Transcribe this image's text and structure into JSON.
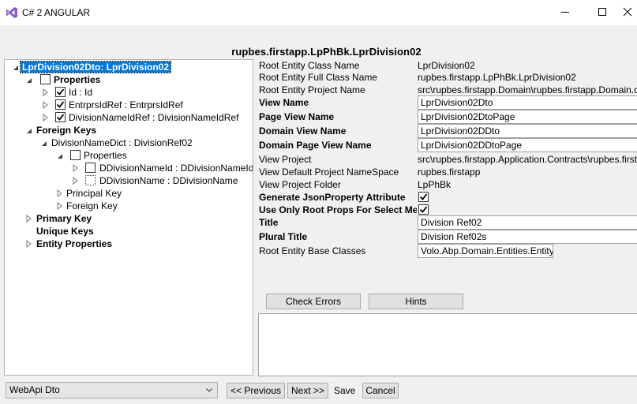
{
  "window": {
    "title": "C# 2 ANGULAR",
    "minimize_icon": "minimize-icon",
    "maximize_icon": "maximize-icon",
    "close_icon": "close-icon"
  },
  "page_title": "rupbes.firstapp.LpPhBk.LprDivision02",
  "tree": {
    "root": "LprDivision02Dto: LprDivision02",
    "properties": "Properties",
    "prop_id": "Id : Id",
    "prop_entrprs": "EntrprsIdRef : EntrprsIdRef",
    "prop_division": "DivisionNameIdRef : DivisionNameIdRef",
    "foreign_keys": "Foreign Keys",
    "division_dict": "DivisionNameDict : DivisionRef02",
    "sub_properties": "Properties",
    "sub_prop_id": "DDivisionNameId : DDivisionNameId",
    "sub_prop_name": "DDivisionName : DDivisionName",
    "principal_key": "Principal Key",
    "sub_foreign_key": "Foreign Key",
    "primary_key": "Primary Key",
    "unique_keys": "Unique Keys",
    "entity_properties": "Entity Properties"
  },
  "props": {
    "root_entity_class_name": {
      "label": "Root Entity Class Name",
      "value": "LprDivision02"
    },
    "root_entity_full_class_name": {
      "label": "Root Entity Full Class Name",
      "value": "rupbes.firstapp.LpPhBk.LprDivision02"
    },
    "root_entity_project_name": {
      "label": "Root Entity Project Name",
      "value": "src\\rupbes.firstapp.Domain\\rupbes.firstapp.Domain.c"
    },
    "view_name": {
      "label": "View Name",
      "value": "LprDivision02Dto"
    },
    "page_view_name": {
      "label": "Page View Name",
      "value": "LprDivision02DtoPage"
    },
    "domain_view_name": {
      "label": "Domain View Name",
      "value": "LprDivision02DDto"
    },
    "domain_page_view_name": {
      "label": "Domain Page View Name",
      "value": "LprDivision02DDtoPage"
    },
    "view_project": {
      "label": "View Project",
      "value": "src\\rupbes.firstapp.Application.Contracts\\rupbes.first"
    },
    "view_default_namespace": {
      "label": "View Default Project NameSpace",
      "value": "rupbes.firstapp"
    },
    "view_project_folder": {
      "label": "View Project Folder",
      "value": "LpPhBk"
    },
    "generate_json": {
      "label": "Generate JsonProperty Attribute"
    },
    "use_root_props": {
      "label": "Use Only Root Props For Select Met"
    },
    "title": {
      "label": "Title",
      "value": "Division Ref02"
    },
    "plural_title": {
      "label": "Plural Title",
      "value": "Division Ref02s"
    },
    "root_entity_base_classes": {
      "label": "Root Entity Base Classes",
      "value": "Volo.Abp.Domain.Entities.Entity"
    }
  },
  "buttons": {
    "check_errors": "Check Errors",
    "hints": "Hints",
    "previous": "<< Previous",
    "next": "Next >>",
    "save": "Save",
    "cancel": "Cancel"
  },
  "mode_select": {
    "value": "WebApi Dto"
  }
}
